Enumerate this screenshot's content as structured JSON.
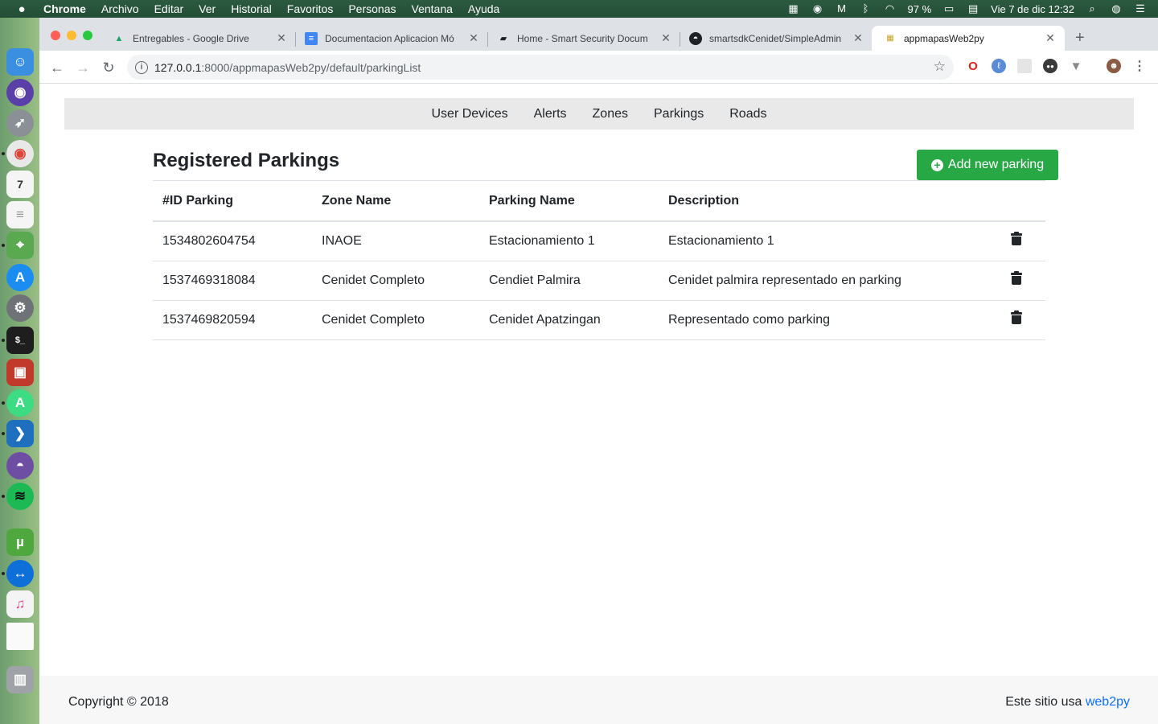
{
  "menubar": {
    "apple": "",
    "items": [
      "Chrome",
      "Archivo",
      "Editar",
      "Ver",
      "Historial",
      "Favoritos",
      "Personas",
      "Ventana",
      "Ayuda"
    ],
    "battery": "97 %",
    "datetime": "Vie 7 de dic  12:32"
  },
  "browser": {
    "tabs": [
      {
        "title": "Entregables - Google Drive",
        "icon": "google-drive-icon"
      },
      {
        "title": "Documentacion Aplicacion Mó",
        "icon": "google-docs-icon"
      },
      {
        "title": "Home - Smart Security Docum",
        "icon": "book-icon"
      },
      {
        "title": "smartsdkCenidet/SimpleAdmin",
        "icon": "github-icon"
      },
      {
        "title": "appmapasWeb2py",
        "icon": "web2py-icon"
      }
    ],
    "url_host": "127.0.0.1",
    "url_rest": ":8000/appmapasWeb2py/default/parkingList"
  },
  "nav": {
    "items": [
      "User Devices",
      "Alerts",
      "Zones",
      "Parkings",
      "Roads"
    ]
  },
  "main": {
    "heading": "Registered Parkings",
    "add_button": "Add new parking",
    "columns": [
      "#ID Parking",
      "Zone Name",
      "Parking Name",
      "Description"
    ],
    "rows": [
      {
        "id": "1534802604754",
        "zone": "INAOE",
        "name": "Estacionamiento 1",
        "description": "Estacionamiento 1"
      },
      {
        "id": "1537469318084",
        "zone": "Cenidet Completo",
        "name": "Cendiet Palmira",
        "description": "Cenidet palmira representado en parking"
      },
      {
        "id": "1537469820594",
        "zone": "Cenidet Completo",
        "name": "Cenidet Apatzingan",
        "description": "Representado como parking"
      }
    ]
  },
  "footer": {
    "copyright": "Copyright © 2018",
    "powered_prefix": "Este sitio usa ",
    "powered_link": "web2py"
  },
  "colors": {
    "accent_green": "#28a745",
    "link_blue": "#0d6efd",
    "nav_bg": "#e9e9e9"
  }
}
